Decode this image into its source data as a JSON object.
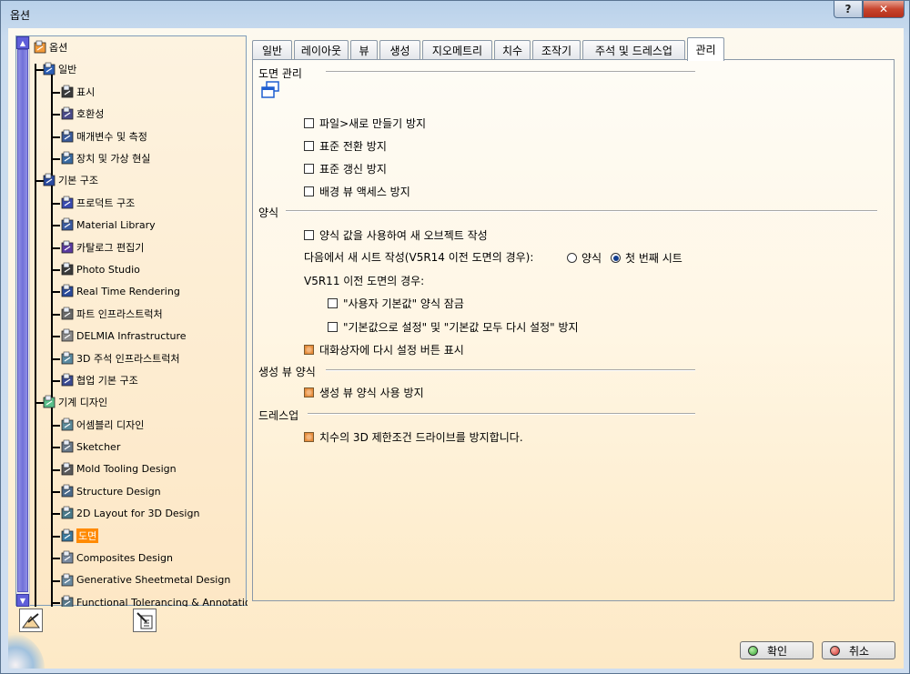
{
  "window": {
    "title": "옵션",
    "help_label": "?",
    "close_label": "✕"
  },
  "tree": {
    "items": [
      {
        "label": "옵션",
        "icon": "options-icon"
      },
      {
        "label": "일반",
        "icon": "general-icon"
      },
      {
        "label": "표시",
        "icon": "display-icon"
      },
      {
        "label": "호환성",
        "icon": "compatibility-icon"
      },
      {
        "label": "매개변수 및 측정",
        "icon": "parameters-icon"
      },
      {
        "label": "장치 및 가상 현실",
        "icon": "devices-icon"
      },
      {
        "label": "기본 구조",
        "icon": "infrastructure-icon"
      },
      {
        "label": "프로덕트 구조",
        "icon": "product-structure-icon"
      },
      {
        "label": "Material Library",
        "icon": "material-library-icon"
      },
      {
        "label": "카탈로그 편집기",
        "icon": "catalog-editor-icon"
      },
      {
        "label": "Photo Studio",
        "icon": "photo-studio-icon"
      },
      {
        "label": "Real Time Rendering",
        "icon": "rendering-icon"
      },
      {
        "label": "파트 인프라스트럭처",
        "icon": "part-infrastructure-icon"
      },
      {
        "label": "DELMIA Infrastructure",
        "icon": "delmia-icon"
      },
      {
        "label": "3D 주석 인프라스트럭처",
        "icon": "annotation-infrastructure-icon"
      },
      {
        "label": "협업 기본 구조",
        "icon": "collaboration-icon"
      },
      {
        "label": "기계 디자인",
        "icon": "mechanical-design-icon"
      },
      {
        "label": "어셈블리 디자인",
        "icon": "assembly-design-icon"
      },
      {
        "label": "Sketcher",
        "icon": "sketcher-icon"
      },
      {
        "label": "Mold Tooling Design",
        "icon": "mold-tooling-icon"
      },
      {
        "label": "Structure Design",
        "icon": "structure-design-icon"
      },
      {
        "label": "2D Layout for 3D Design",
        "icon": "layout-2d-icon"
      },
      {
        "label": "도면",
        "icon": "drawing-icon"
      },
      {
        "label": "Composites Design",
        "icon": "composites-icon"
      },
      {
        "label": "Generative Sheetmetal Design",
        "icon": "sheetmetal-icon"
      },
      {
        "label": "Functional Tolerancing & Annotation",
        "icon": "tolerancing-icon"
      }
    ],
    "selected": "도면"
  },
  "tabs": [
    "일반",
    "레이아웃",
    "뷰",
    "생성",
    "지오메트리",
    "치수",
    "조작기",
    "주석 및 드레스업",
    "관리"
  ],
  "active_tab": "관리",
  "panel": {
    "section1": {
      "title": "도면 관리",
      "options": [
        {
          "label": "파일>새로 만들기 방지",
          "checked": false
        },
        {
          "label": "표준 전환 방지",
          "checked": false
        },
        {
          "label": "표준 갱신 방지",
          "checked": false
        },
        {
          "label": "배경 뷰 액세스 방지",
          "checked": false
        }
      ]
    },
    "section2": {
      "title": "양식",
      "create_option": {
        "label": "양식 값을 사용하여 새 오브젝트 작성",
        "checked": false
      },
      "new_sheet_label": "다음에서 새 시트 작성(V5R14 이전 도면의 경우):",
      "radio_style": {
        "label": "양식",
        "selected": false
      },
      "radio_first": {
        "label": "첫 번째 시트",
        "selected": true
      },
      "before_label": "V5R11 이전 도면의 경우:",
      "lock_option": {
        "label": "\"사용자 기본값\" 양식 잠금",
        "checked": false
      },
      "reset_option": {
        "label": "\"기본값으로 설정\" 및 \"기본값 모두 다시 설정\" 방지",
        "checked": false
      },
      "show_reset": {
        "label": "대화상자에 다시 설정 버튼 표시",
        "checked": true
      }
    },
    "section3": {
      "title": "생성 뷰 양식",
      "option": {
        "label": "생성 뷰 양식 사용 방지",
        "checked": true
      }
    },
    "section4": {
      "title": "드레스업",
      "option": {
        "label": "치수의 3D 제한조건 드라이브를 방지합니다.",
        "checked": true
      }
    }
  },
  "buttons": {
    "ok": "확인",
    "cancel": "취소"
  },
  "colors": {
    "selected": "#ff8a00",
    "ok_dot": "#2fa52f",
    "cancel_dot": "#d42c2c"
  }
}
